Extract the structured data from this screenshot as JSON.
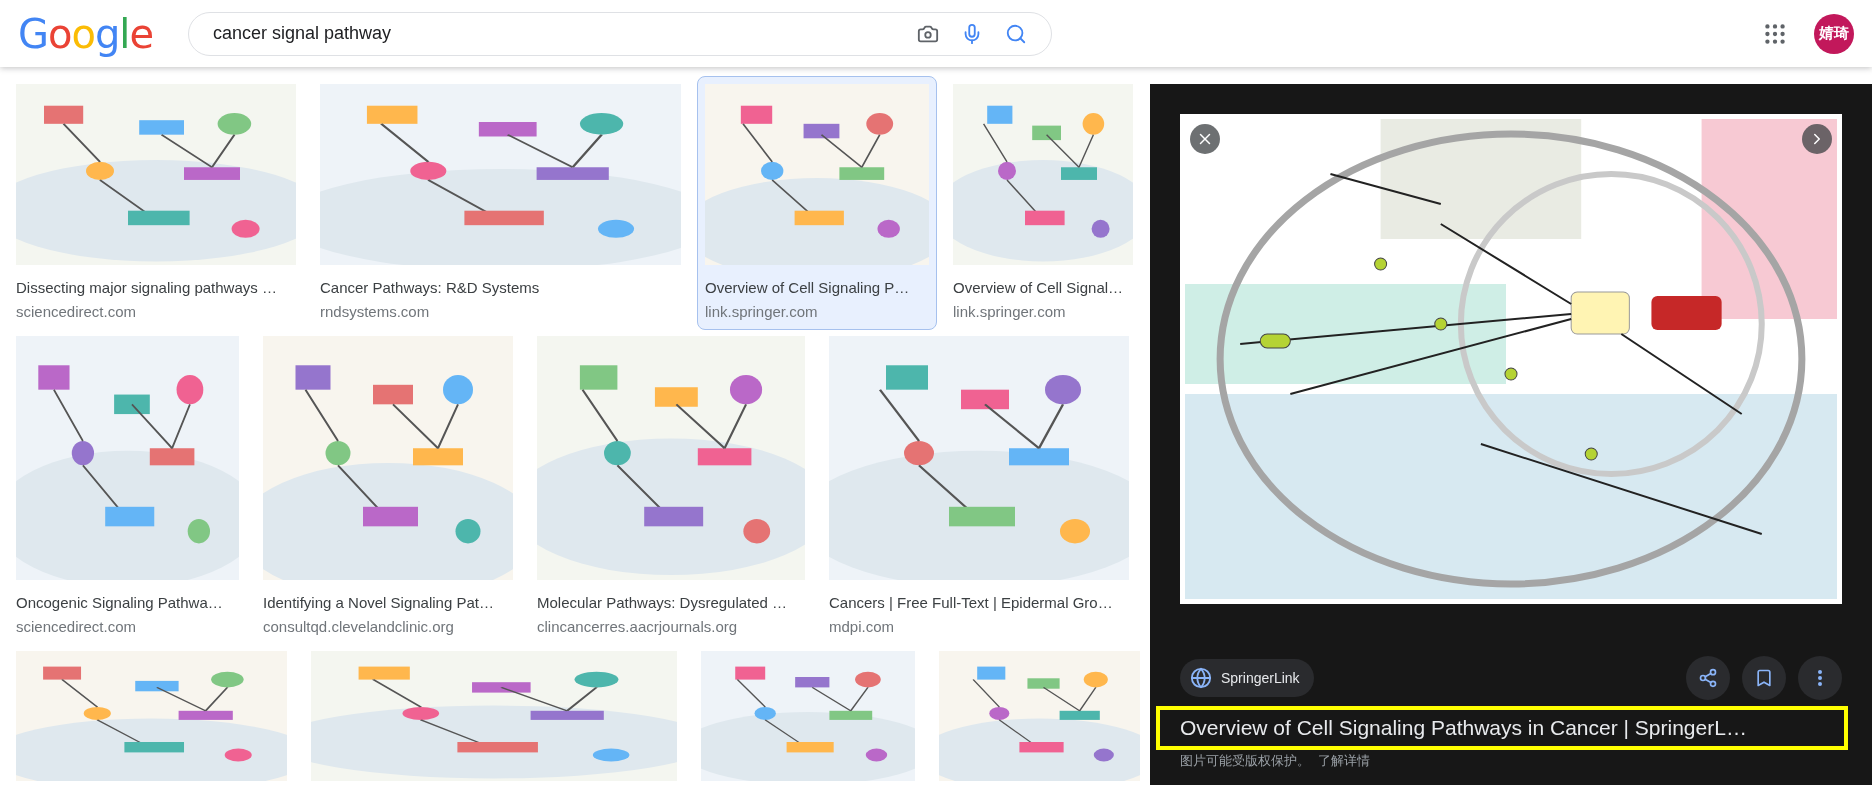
{
  "logo": "Google",
  "search": {
    "value": "cancer signal pathway"
  },
  "avatar": "婧琦",
  "rows": [
    {
      "cards": [
        {
          "title": "Dissecting major signaling pathways …",
          "source": "sciencedirect.com",
          "selected": false
        },
        {
          "title": "Cancer Pathways: R&D Systems",
          "source": "rndsystems.com",
          "selected": false
        },
        {
          "title": "Overview of Cell Signaling P…",
          "source": "link.springer.com",
          "selected": true
        },
        {
          "title": "Overview of Cell Signal…",
          "source": "link.springer.com",
          "selected": false
        }
      ]
    },
    {
      "cards": [
        {
          "title": "Oncogenic Signaling Pathwa…",
          "source": "sciencedirect.com",
          "selected": false
        },
        {
          "title": "Identifying a Novel Signaling Pat…",
          "source": "consultqd.clevelandclinic.org",
          "selected": false
        },
        {
          "title": "Molecular Pathways: Dysregulated …",
          "source": "clincancerres.aacrjournals.org",
          "selected": false
        },
        {
          "title": "Cancers | Free Full-Text | Epidermal Gro…",
          "source": "mdpi.com",
          "selected": false
        }
      ]
    },
    {
      "cards": [
        {
          "selected": false
        },
        {
          "selected": false
        },
        {
          "selected": false
        },
        {
          "selected": false
        }
      ]
    }
  ],
  "preview": {
    "source": "SpringerLink",
    "title": "Overview of Cell Signaling Pathways in Cancer | SpringerL…",
    "notice": "图片可能受版权保护。",
    "link": "了解详情",
    "highlighted": true
  }
}
